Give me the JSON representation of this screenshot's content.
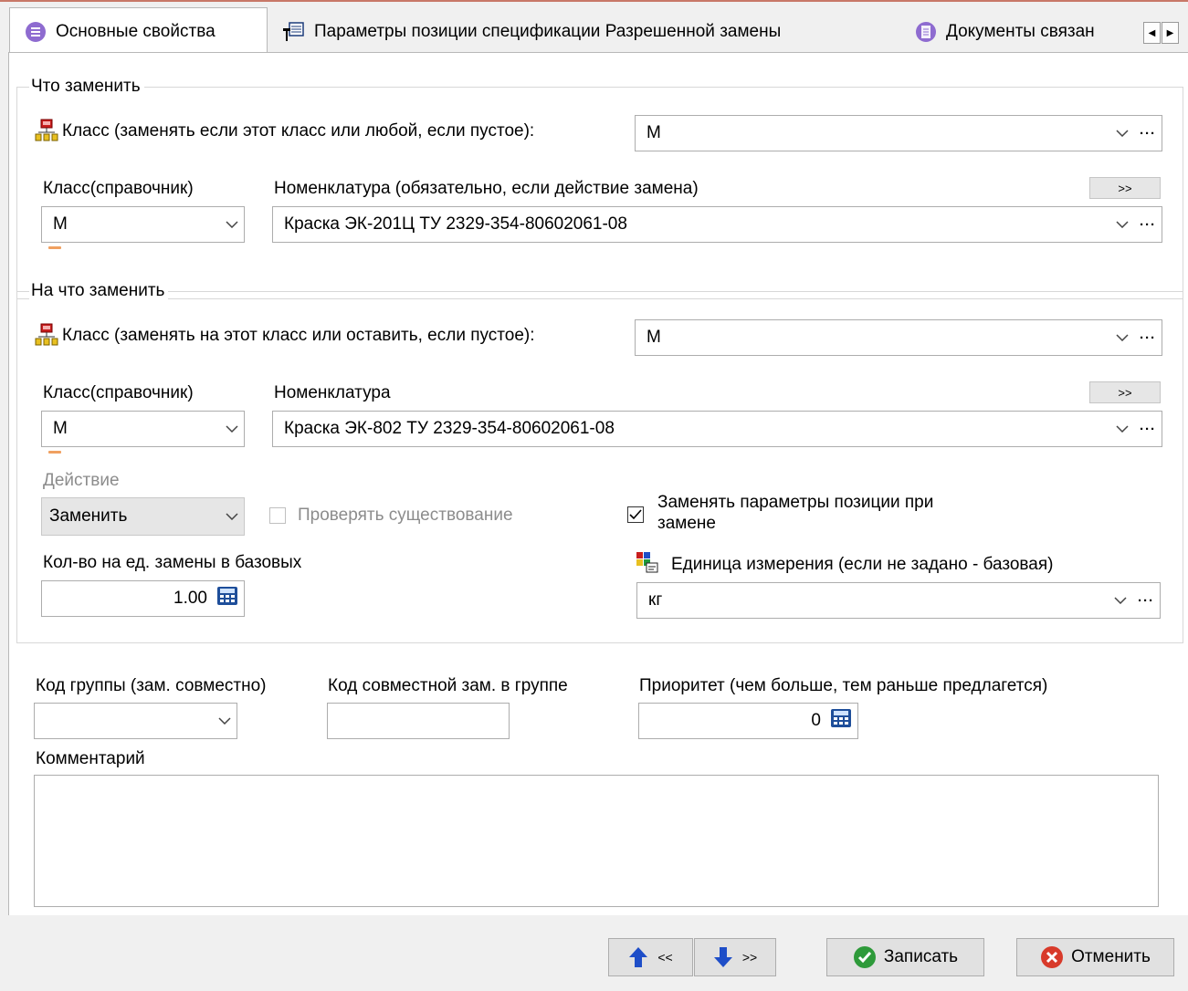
{
  "tabs": [
    {
      "label": "Основные свойства",
      "icon": "list-circle-icon"
    },
    {
      "label": "Параметры позиции спецификации Разрешенной замены",
      "icon": "table-pin-icon"
    },
    {
      "label": "Документы связан",
      "icon": "document-circle-icon"
    }
  ],
  "what_replace": {
    "legend": "Что заменить",
    "class_label": "Класс (заменять если этот класс или любой, если пустое):",
    "class_value": "М",
    "ref_class_label": "Класс(справочник)",
    "ref_class_value": "М",
    "nomenclature_label": "Номенклатура (обязательно, если действие замена)",
    "nomenclature_value": "Краска ЭК-201Ц ТУ 2329-354-80602061-08",
    "more_label": ">>"
  },
  "replace_with": {
    "legend": "На что заменить",
    "class_label": "Класс (заменять на этот класс или оставить, если пустое):",
    "class_value": "М",
    "ref_class_label": "Класс(справочник)",
    "ref_class_value": "М",
    "nomenclature_label": "Номенклатура",
    "nomenclature_value": "Краска ЭК-802 ТУ 2329-354-80602061-08",
    "more_label": ">>",
    "action_label": "Действие",
    "action_value": "Заменить",
    "check_exists_label": "Проверять существование",
    "replace_params_label_line1": "Заменять параметры позиции при",
    "replace_params_label_line2": "замене",
    "qty_label": "Кол-во на ед. замены в базовых",
    "qty_value": "1.00",
    "unit_label": "Единица измерения (если не задано - базовая)",
    "unit_value": "кг"
  },
  "group": {
    "group_code_label": "Код группы (зам. совместно)",
    "group_code_value": "",
    "joint_code_label": "Код совместной зам. в группе",
    "joint_code_value": "",
    "priority_label": "Приоритет (чем больше, тем раньше предлагется)",
    "priority_value": "0",
    "comment_label": "Комментарий",
    "comment_value": ""
  },
  "footer": {
    "prev_label": "<<",
    "next_label": ">>",
    "save_label": "Записать",
    "cancel_label": "Отменить"
  }
}
